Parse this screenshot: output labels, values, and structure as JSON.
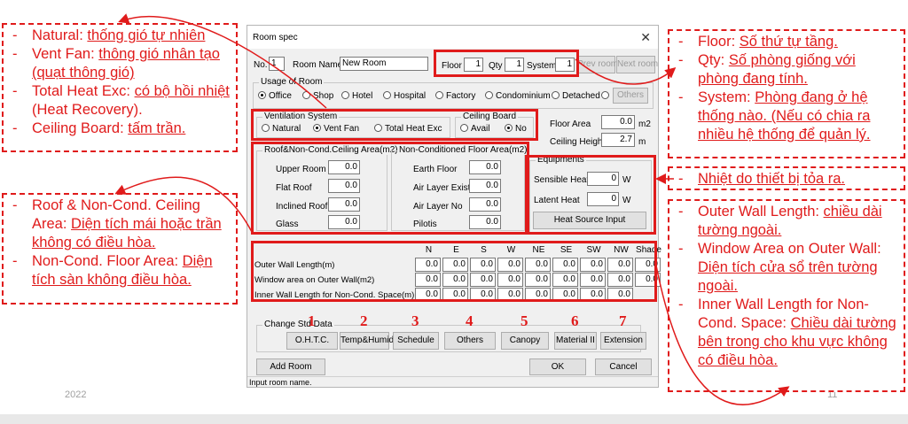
{
  "slide": {
    "year": "2022",
    "page": "11"
  },
  "notes": {
    "top_left": [
      {
        "term": "Natural",
        "desc": "thống gió tự nhiên"
      },
      {
        "term": "Vent Fan",
        "desc": "thông gió nhân tạo (quạt thông gió)"
      },
      {
        "term": "Total Heat Exc",
        "desc": "có bộ hồi nhiệt",
        "extra": "(Heat Recovery)."
      },
      {
        "term": "Ceiling Board",
        "desc": "tấm trần."
      }
    ],
    "mid_left": [
      {
        "term": "Roof & Non-Cond. Ceiling Area",
        "desc": "Diện tích mái hoặc trần không có điều hòa."
      },
      {
        "term": "Non-Cond. Floor Area",
        "desc": "Diện tích sàn không điều hòa."
      }
    ],
    "top_right": [
      {
        "term": "Floor",
        "desc": "Số thứ tự tầng."
      },
      {
        "term": "Qty",
        "desc": "Số phòng giống với phòng đang tính."
      },
      {
        "term": "System",
        "desc": "Phòng đang ở hệ thống nào. (Nếu có chia ra nhiều hệ thống để quản lý."
      }
    ],
    "mid_right": "Nhiệt do thiết bị tỏa ra.",
    "bottom_right": [
      {
        "term": "Outer Wall Length",
        "desc": "chiều dài tường ngoài."
      },
      {
        "term": "Window Area on Outer Wall",
        "desc": "Diện tích cửa sổ trên tường ngoài."
      },
      {
        "term": "Inner Wall Length for Non-Cond. Space",
        "desc": "Chiều dài tường bên trong cho khu vực không có điều hòa."
      }
    ]
  },
  "dialog": {
    "title": "Room spec",
    "close": "✕",
    "no_label": "No.",
    "no_value": "1",
    "room_name_label": "Room Name",
    "room_name_value": "New Room",
    "floor_label": "Floor",
    "floor_value": "1",
    "qty_label": "Qty",
    "qty_value": "1",
    "system_label": "System",
    "system_value": "1",
    "prev_room": "Prev room",
    "next_room": "Next room",
    "usage": {
      "label": "Usage of Room",
      "options": [
        "Office",
        "Shop",
        "Hotel",
        "Hospital",
        "Factory",
        "Condominium",
        "Detached",
        ""
      ],
      "selected": "Office",
      "others_btn": "Others"
    },
    "ventilation": {
      "label": "Ventilation System",
      "options": [
        "Natural",
        "Vent Fan",
        "Total Heat Exc"
      ],
      "selected": "Vent Fan"
    },
    "ceiling_board": {
      "label": "Ceiling Board",
      "options": [
        "Avail",
        "No"
      ],
      "selected": "No"
    },
    "floor_area": {
      "label": "Floor Area",
      "value": "0.0",
      "unit": "m2"
    },
    "ceiling_height": {
      "label": "Ceiling Height",
      "value": "2.7",
      "unit": "m"
    },
    "roof": {
      "label": "Roof&Non-Cond.Ceiling Area(m2)",
      "rows": [
        {
          "label": "Upper Room",
          "value": "0.0"
        },
        {
          "label": "Flat Roof",
          "value": "0.0"
        },
        {
          "label": "Inclined Roof",
          "value": "0.0"
        },
        {
          "label": "Glass",
          "value": "0.0"
        }
      ]
    },
    "noncond_floor": {
      "label": "Non-Conditioned Floor Area(m2)",
      "rows": [
        {
          "label": "Earth Floor",
          "value": "0.0"
        },
        {
          "label": "Air Layer Exist",
          "value": "0.0"
        },
        {
          "label": "Air Layer No",
          "value": "0.0"
        },
        {
          "label": "Pilotis",
          "value": "0.0"
        }
      ]
    },
    "equipments": {
      "label": "Equipments",
      "sensible_label": "Sensible Heat",
      "sensible_value": "0",
      "sensible_unit": "W",
      "latent_label": "Latent Heat",
      "latent_value": "0",
      "latent_unit": "W",
      "heat_source_btn": "Heat Source Input"
    },
    "walls": {
      "columns": [
        "N",
        "E",
        "S",
        "W",
        "NE",
        "SE",
        "SW",
        "NW",
        "Shade"
      ],
      "rows": [
        {
          "label": "Outer Wall Length(m)",
          "values": [
            "0.0",
            "0.0",
            "0.0",
            "0.0",
            "0.0",
            "0.0",
            "0.0",
            "0.0",
            "0.0"
          ]
        },
        {
          "label": "Window area on Outer Wall(m2)",
          "values": [
            "0.0",
            "0.0",
            "0.0",
            "0.0",
            "0.0",
            "0.0",
            "0.0",
            "0.0",
            "0.0"
          ]
        },
        {
          "label": "Inner Wall Length for Non-Cond. Space(m)",
          "values": [
            "0.0",
            "0.0",
            "0.0",
            "0.0",
            "0.0",
            "0.0",
            "0.0",
            "0.0"
          ]
        }
      ]
    },
    "change_std": {
      "label": "Change Std Data",
      "buttons": [
        "O.H.T.C.",
        "Temp&Humid",
        "Schedule",
        "Others",
        "Canopy",
        "Material II",
        "Extension"
      ],
      "numbers": [
        "1",
        "2",
        "3",
        "4",
        "5",
        "6",
        "7"
      ]
    },
    "add_room": "Add Room",
    "ok": "OK",
    "cancel": "Cancel",
    "status": "Input room name."
  }
}
